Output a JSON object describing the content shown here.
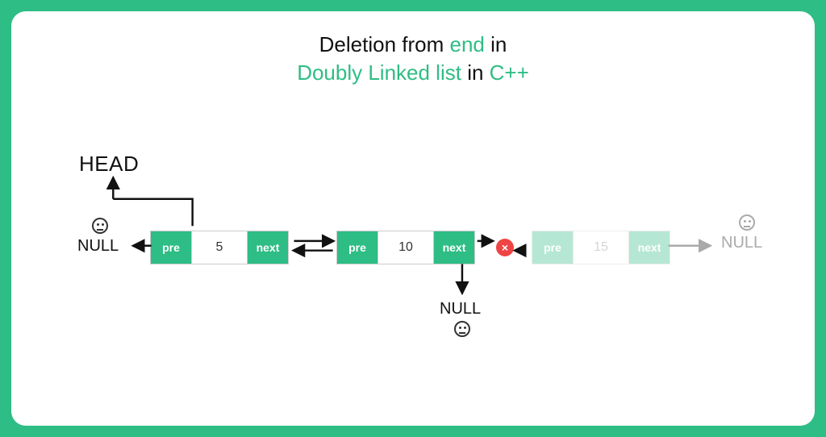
{
  "title": {
    "line1_pre": "Deletion from ",
    "line1_accent": "end",
    "line1_post": " in",
    "line2_accent1": "Doubly Linked list",
    "line2_mid": " in ",
    "line2_accent2": "C++"
  },
  "labels": {
    "head": "HEAD",
    "null_left": "NULL",
    "null_bottom": "NULL",
    "null_right": "NULL"
  },
  "nodes": {
    "n1": {
      "pre": "pre",
      "val": "5",
      "next": "next"
    },
    "n2": {
      "pre": "pre",
      "val": "10",
      "next": "next"
    },
    "n3": {
      "pre": "pre",
      "val": "15",
      "next": "next"
    }
  },
  "colors": {
    "accent": "#2ebd85",
    "error": "#ef4444"
  }
}
